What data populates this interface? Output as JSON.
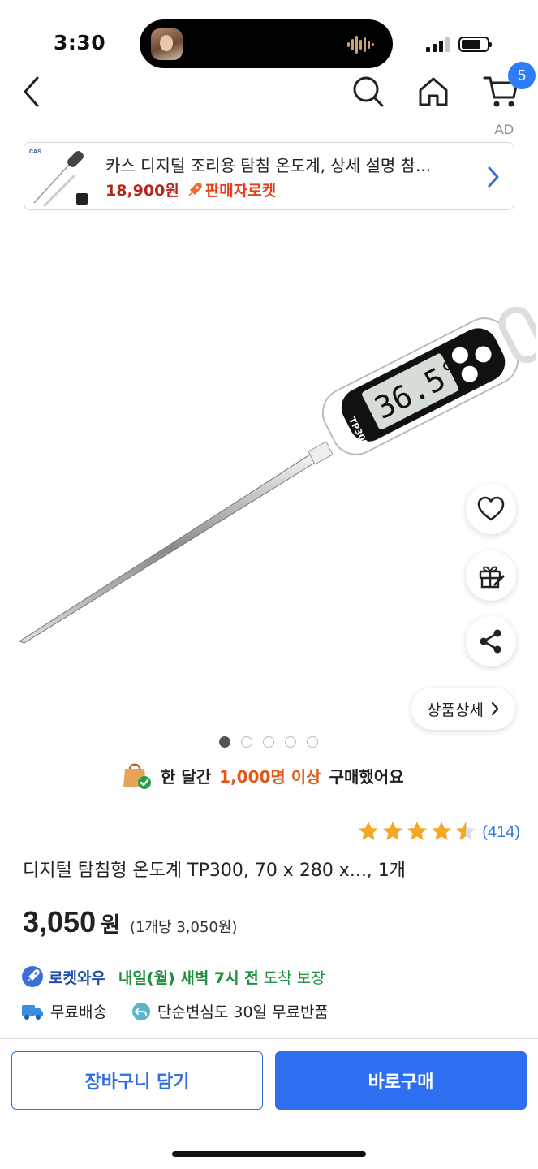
{
  "status_bar": {
    "time": "3:30",
    "battery_level": 0.78
  },
  "nav": {
    "back_icon": "chevron-left-icon",
    "search_icon": "search-icon",
    "home_icon": "home-icon",
    "cart_icon": "cart-icon",
    "cart_count": "5"
  },
  "ad": {
    "label": "AD",
    "title": "카스 디지털 조리용 탐침 온도계, 상세 설명 참...",
    "price": "18,900원",
    "badge": "판매자로켓",
    "thumb_text": "CAS"
  },
  "product_image": {
    "display_reading": "36.5°C",
    "model": "TP300"
  },
  "actions": {
    "wishlist_icon": "heart-icon",
    "gift_icon": "gift-icon",
    "share_icon": "share-icon",
    "detail_label": "상품상세"
  },
  "carousel": {
    "count": 5,
    "active_index": 0
  },
  "purchase_info": {
    "prefix": "한 달간",
    "highlight": "1,000명 이상",
    "suffix": "구매했어요"
  },
  "rating": {
    "stars": 4.5,
    "review_count": "(414)"
  },
  "product": {
    "title": "디지털 탐침형 온도계 TP300, 70 x 280 x..., 1개",
    "price": "3,050",
    "currency": "원",
    "unit_price": "(1개당 3,050원)"
  },
  "delivery": {
    "rocket_label": "로켓와우",
    "date": "내일(월) 새벽 7시 전",
    "suffix": "도착 보장",
    "free_shipping": "무료배송",
    "return_policy": "단순변심도 30일 무료반품"
  },
  "buttons": {
    "add_to_cart": "장바구니 담기",
    "buy_now": "바로구매"
  },
  "colors": {
    "accent": "#2E6FF2",
    "price_red": "#B3261E",
    "delivery_green": "#1E8F3E",
    "highlight_orange": "#E0591B"
  }
}
